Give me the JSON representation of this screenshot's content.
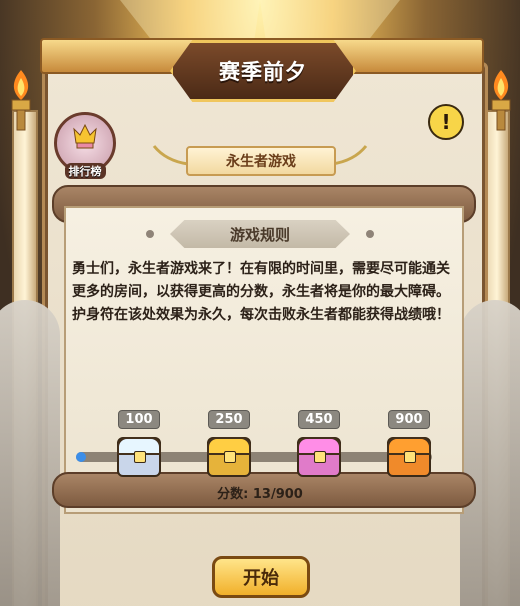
{
  "window_title": "赛季前夕",
  "ranking_button": {
    "label": "排行榜"
  },
  "alert_button": {
    "symbol": "!"
  },
  "mode_name": "永生者游戏",
  "rules": {
    "header": "游戏规则",
    "paragraphs": [
      "勇士们，永生者游戏来了！在有限的时间里，需要尽可能通关更多的房间，以获得更高的分数，永生者将是你的最大障碍。",
      "护身符在该处效果为永久，每次击败永生者都能获得战绩哦！"
    ]
  },
  "progress": {
    "score_label": "分数: 13/900",
    "current": 13,
    "max": 900,
    "fill_fraction": 0.014
  },
  "rewards": [
    {
      "threshold": "100",
      "chest": "silver-chest",
      "color": "#c9d6ea"
    },
    {
      "threshold": "250",
      "chest": "gold-teal-chest",
      "color": "#e6b33a"
    },
    {
      "threshold": "450",
      "chest": "pink-chest",
      "color": "#e07bc9"
    },
    {
      "threshold": "900",
      "chest": "orange-gem-chest",
      "color": "#f08a2a"
    }
  ],
  "start_button": {
    "label": "开始"
  },
  "colors": {
    "accent": "#f1b02a",
    "progress": "#3b8ee8"
  }
}
